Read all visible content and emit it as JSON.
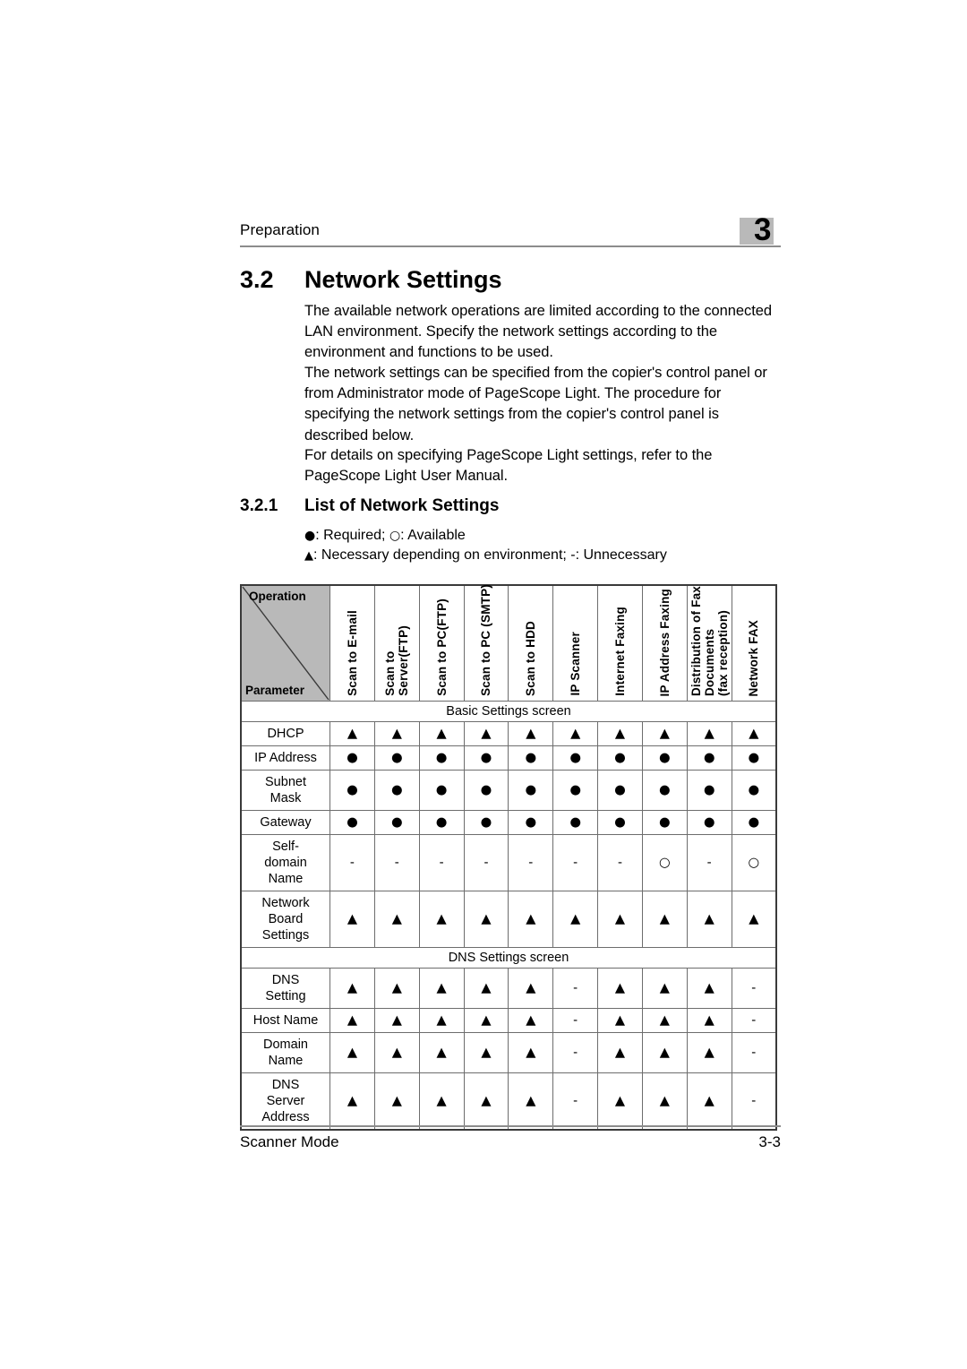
{
  "header": {
    "running_head": "Preparation",
    "chapter_number": "3"
  },
  "section": {
    "number": "3.2",
    "title": "Network Settings"
  },
  "paragraphs": [
    "The available network operations are limited according to the connected LAN environment. Specify the network settings according to the environment and functions to be used.",
    "The network settings can be specified from the copier's control panel or from Administrator mode of PageScope Light. The procedure for specifying the network settings from the copier's control panel is described below.",
    "For details on specifying PageScope Light settings, refer to the PageScope Light User Manual."
  ],
  "subsection": {
    "number": "3.2.1",
    "title": "List of Network Settings"
  },
  "legend": {
    "line1_filled": "●",
    "line1_filled_label": ": Required;",
    "line1_open": "○",
    "line1_open_label": ": Available",
    "line2_triangle": "▲",
    "line2_triangle_label": ": Necessary depending on environment; -: Unnecessary"
  },
  "table": {
    "corner_operation": "Operation",
    "corner_parameter": "Parameter",
    "columns": [
      "Scan to E-mail",
      "Scan to\nServer(FTP)",
      "Scan to PC(FTP)",
      "Scan to PC (SMTP)",
      "Scan to HDD",
      "IP Scanner",
      "Internet Faxing",
      "IP Address Faxing",
      "Distribution of Fax\nDocuments\n(fax reception)",
      "Network FAX"
    ],
    "rows": [
      {
        "kind": "section",
        "label": "Basic Settings screen"
      },
      {
        "kind": "data",
        "label": "DHCP",
        "lines": 1,
        "values": [
          "▲",
          "▲",
          "▲",
          "▲",
          "▲",
          "▲",
          "▲",
          "▲",
          "▲",
          "▲"
        ]
      },
      {
        "kind": "data",
        "label": "IP Address",
        "lines": 1,
        "values": [
          "●",
          "●",
          "●",
          "●",
          "●",
          "●",
          "●",
          "●",
          "●",
          "●"
        ]
      },
      {
        "kind": "data",
        "label": "Subnet\nMask",
        "lines": 2,
        "values": [
          "●",
          "●",
          "●",
          "●",
          "●",
          "●",
          "●",
          "●",
          "●",
          "●"
        ]
      },
      {
        "kind": "data",
        "label": "Gateway",
        "lines": 1,
        "values": [
          "●",
          "●",
          "●",
          "●",
          "●",
          "●",
          "●",
          "●",
          "●",
          "●"
        ]
      },
      {
        "kind": "data",
        "label": "Self-\ndomain\nName",
        "lines": 3,
        "values": [
          "-",
          "-",
          "-",
          "-",
          "-",
          "-",
          "-",
          "○",
          "-",
          "○"
        ]
      },
      {
        "kind": "data",
        "label": "Network\nBoard\nSettings",
        "lines": 3,
        "values": [
          "▲",
          "▲",
          "▲",
          "▲",
          "▲",
          "▲",
          "▲",
          "▲",
          "▲",
          "▲"
        ]
      },
      {
        "kind": "section",
        "label": "DNS Settings screen"
      },
      {
        "kind": "data",
        "label": "DNS\nSetting",
        "lines": 2,
        "values": [
          "▲",
          "▲",
          "▲",
          "▲",
          "▲",
          "-",
          "▲",
          "▲",
          "▲",
          "-"
        ]
      },
      {
        "kind": "data",
        "label": "Host Name",
        "lines": 1,
        "values": [
          "▲",
          "▲",
          "▲",
          "▲",
          "▲",
          "-",
          "▲",
          "▲",
          "▲",
          "-"
        ]
      },
      {
        "kind": "data",
        "label": "Domain\nName",
        "lines": 2,
        "values": [
          "▲",
          "▲",
          "▲",
          "▲",
          "▲",
          "-",
          "▲",
          "▲",
          "▲",
          "-"
        ]
      },
      {
        "kind": "data",
        "label": "DNS\nServer\nAddress",
        "lines": 3,
        "values": [
          "▲",
          "▲",
          "▲",
          "▲",
          "▲",
          "-",
          "▲",
          "▲",
          "▲",
          "-"
        ]
      }
    ]
  },
  "footer": {
    "left": "Scanner Mode",
    "page_number": "3-3"
  }
}
